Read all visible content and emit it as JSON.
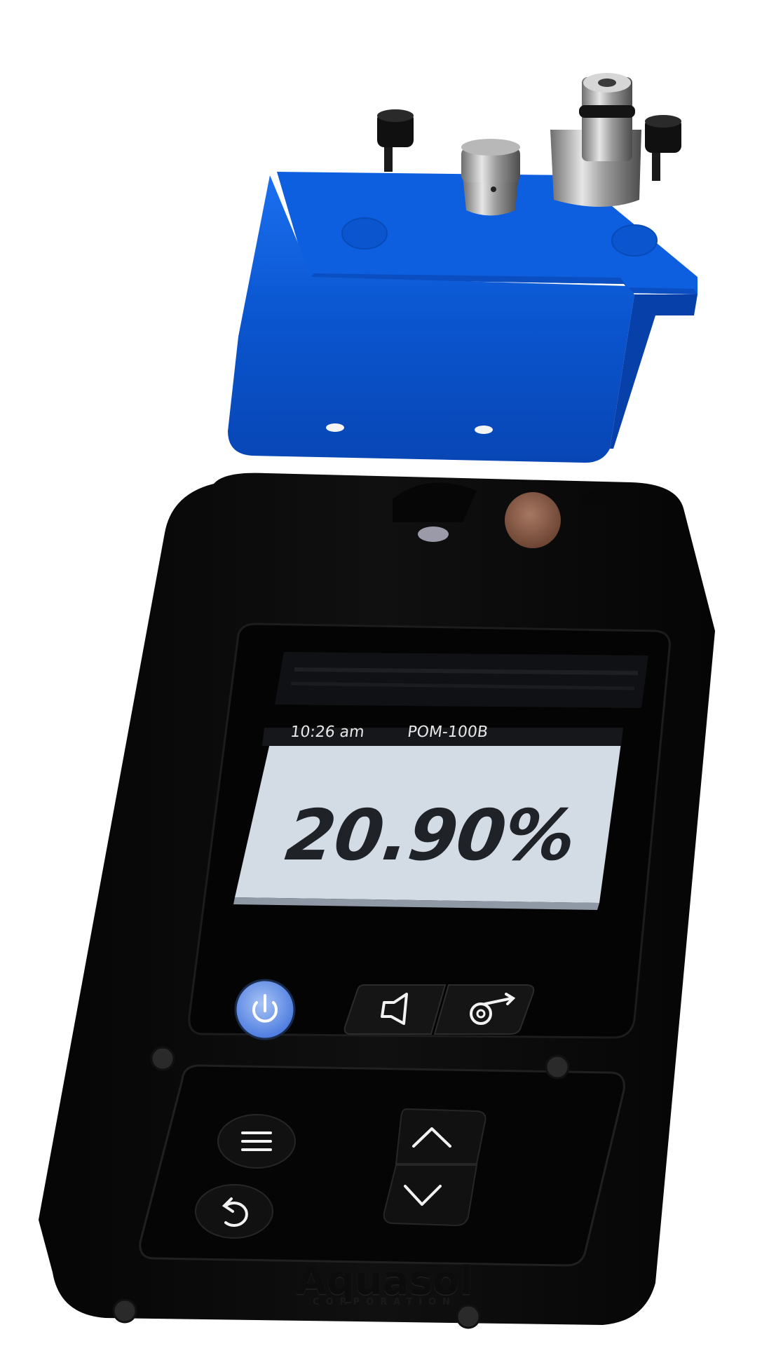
{
  "display": {
    "time": "10:26 am",
    "model": "POM-100B",
    "reading": "20.90%"
  },
  "brand": {
    "name": "Aquasol",
    "subtitle": "CORPORATION"
  },
  "controls": {
    "power_icon": "power-icon",
    "sound_icon": "speaker-icon",
    "pump_icon": "pump-icon",
    "menu_icon": "menu-icon",
    "back_icon": "back-arrow-icon",
    "up_icon": "chevron-up-icon",
    "down_icon": "chevron-down-icon"
  },
  "colors": {
    "cap_blue": "#0a5bd6",
    "body_black": "#0b0b0b",
    "lcd_background": "#d3dbe5",
    "power_button": "#6c96e6",
    "valve_brown": "#8a5a45"
  }
}
